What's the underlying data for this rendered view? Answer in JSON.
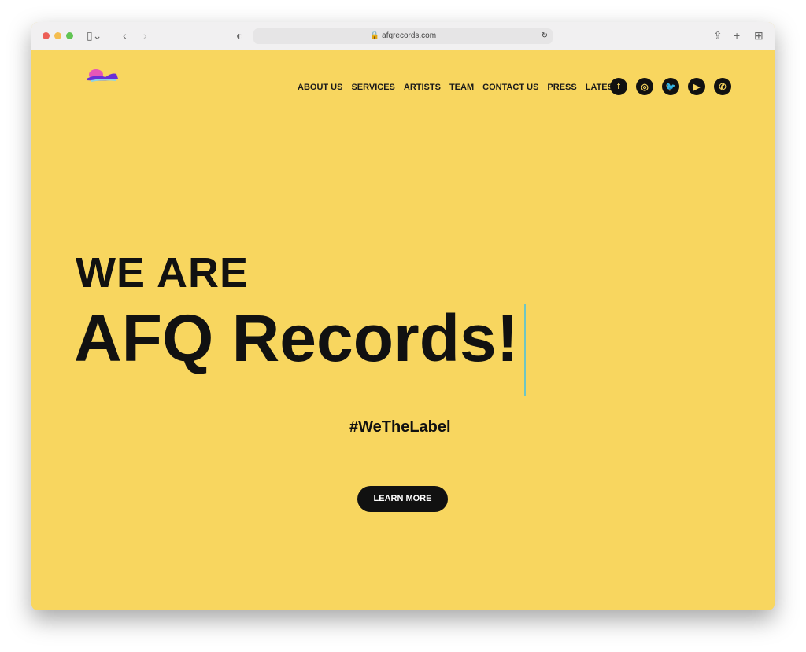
{
  "browser": {
    "url": "afqrecords.com"
  },
  "nav": {
    "items": [
      "ABOUT US",
      "SERVICES",
      "ARTISTS",
      "TEAM",
      "CONTACT US",
      "PRESS",
      "LATEST"
    ]
  },
  "social": [
    {
      "icon": "facebook-icon",
      "glyph": "f"
    },
    {
      "icon": "instagram-icon",
      "glyph": "◎"
    },
    {
      "icon": "twitter-icon",
      "glyph": "🐦"
    },
    {
      "icon": "youtube-icon",
      "glyph": "▶"
    },
    {
      "icon": "phone-icon",
      "glyph": "✆"
    }
  ],
  "hero": {
    "line1": "WE ARE",
    "line2": "AFQ Records!",
    "tagline": "#WeTheLabel",
    "button": "LEARN MORE"
  },
  "colors": {
    "background": "#f8d65f",
    "button": "#111111"
  }
}
